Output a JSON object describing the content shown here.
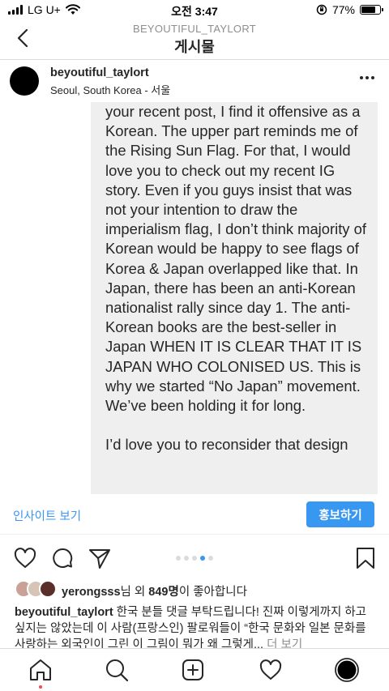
{
  "status_bar": {
    "carrier": "LG U+",
    "time": "오전 3:47",
    "battery": "77%",
    "battery_level": 0.77
  },
  "header": {
    "subtitle": "BEYOUTIFUL_TAYLORT",
    "title": "게시물",
    "back_icon": "chevron-left-icon"
  },
  "post": {
    "username": "beyoutiful_taylort",
    "location": "Seoul, South Korea - 서울",
    "more_icon": "more-horizontal-icon"
  },
  "image": {
    "paragraphs": [
      "your recent post, I find it offensive as a Korean. The upper part reminds me of the Rising Sun Flag. For that, I would love you to check out my recent IG story. Even if you guys insist that was not your intention to draw the imperialism flag, I don’t think majority of Korean would be happy to see flags of Korea & Japan overlapped like that. In Japan, there has been an anti-Korean nationalist rally since day 1. The anti-Korean books are the best-seller in Japan WHEN IT IS CLEAR THAT IT IS JAPAN WHO COLONISED US. This is why we started “No Japan” movement. We’ve been holding it for long.",
      "I’d love you to reconsider that design"
    ]
  },
  "insights": {
    "link_label": "인사이트 보기",
    "promote_label": "홍보하기",
    "accent_color": "#3897f0"
  },
  "carousel": {
    "count": 5,
    "active_index": 3
  },
  "likes": {
    "user": "yerongsss",
    "middle": "님 외 ",
    "count": "849명",
    "suffix": "이 좋아합니다"
  },
  "caption": {
    "username": "beyoutiful_taylort",
    "text": " 한국 분들 댓글 부탁드립니다! 진짜 이렇게까지 하고 싶지는 않았는데 이 사람(프랑스인) 팔로워들이 “한국 문화와 일본 문화를 사랑하는 외국인이 그린 이 그림이 뭐가 왜 그렇게...",
    "more": " 더 보기"
  },
  "tabbar": {
    "icons": [
      "home-icon",
      "search-icon",
      "add-post-icon",
      "activity-heart-icon",
      "profile-icon"
    ]
  }
}
